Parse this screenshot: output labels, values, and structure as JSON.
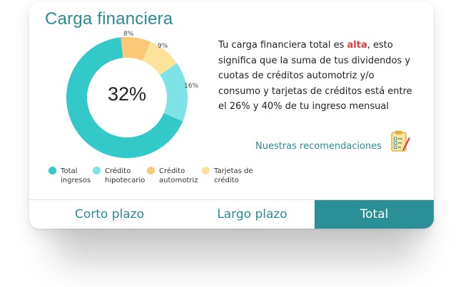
{
  "card": {
    "title": "Carga financiera"
  },
  "donut": {
    "center_text": "32%",
    "slices": [
      {
        "label": "Total ingresos",
        "percent_label": "",
        "value": 67,
        "color": "#34c9c9"
      },
      {
        "label": "Crédito hipotecario",
        "percent_label": "16%",
        "value": 16,
        "color": "#7ee3e6"
      },
      {
        "label": "Tarjetas de crédito",
        "percent_label": "9%",
        "value": 9,
        "color": "#fde49a"
      },
      {
        "label": "Crédito automotriz",
        "percent_label": "8%",
        "value": 8,
        "color": "#fbc877"
      }
    ]
  },
  "legend": {
    "items": [
      {
        "text": "Total\ningresos",
        "color": "#34c9c9"
      },
      {
        "text": "Crédito\nhipotecario",
        "color": "#7ee3e6"
      },
      {
        "text": "Crédito\nautomotriz",
        "color": "#fbc877"
      },
      {
        "text": "Tarjetas de\ncrédito",
        "color": "#fde49a"
      }
    ]
  },
  "description": {
    "before": "Tu carga financiera total es ",
    "highlight": "alta",
    "after": ", esto significa que la suma de tus dividendos y cuotas de créditos automotriz y/o consumo y tarjetas de créditos está entre el 26% y 40% de tu ingreso mensual",
    "highlight_color": "#e63b3b"
  },
  "recommendations": {
    "label": "Nuestras recomendaciones",
    "icon": "clipboard-checklist-icon"
  },
  "tabs": [
    {
      "label": "Corto plazo",
      "active": false
    },
    {
      "label": "Largo plazo",
      "active": false
    },
    {
      "label": "Total",
      "active": true
    }
  ],
  "colors": {
    "accent": "#2a8b93",
    "active_tab": "#2b8f98"
  }
}
